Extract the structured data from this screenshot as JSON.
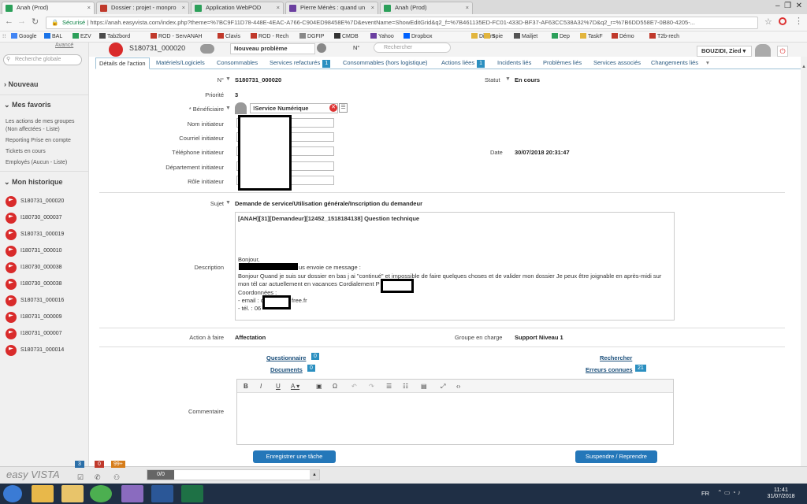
{
  "browser": {
    "tabs": [
      {
        "label": "Anah (Prod)",
        "color": "#2ca05a"
      },
      {
        "label": "Dossier : projet - monpro",
        "color": "#c0392b"
      },
      {
        "label": "Application WebPOD",
        "color": "#2ca05a"
      },
      {
        "label": "Pierre Ménès : quand un",
        "color": "#6b3fa0"
      },
      {
        "label": "Anah (Prod)",
        "color": "#2ca05a"
      }
    ],
    "secure_label": "Sécurisé",
    "url": "https://anah.easyvista.com/index.php?theme=%7BC9F11D78-448E-4EAC-A766-C904ED98458E%7D&eventName=ShowEditGrid&q2_f=%7B461135ED-FC01-433D-BF37-AF63CC538A32%7D&q2_r=%7B6DD558E7-0B80-4205-...",
    "bookmarks": [
      "Google",
      "BAL",
      "EZV",
      "Tab2bord",
      "ROD - ServANAH",
      "Clavis",
      "ROD - Rech",
      "DGFIP",
      "CMDB",
      "Yahoo",
      "Dropbox",
      "Divers",
      "Spie",
      "Mailjet",
      "Dep",
      "TaskF",
      "Démo",
      "T2b-rech"
    ]
  },
  "header": {
    "ticket_id": "S180731_000020",
    "ticket_type": "Nouveau problème",
    "search_prefix": "N°",
    "search_placeholder": "Rechercher",
    "user": "BOUZIDI, Zied"
  },
  "sidebar": {
    "avance": "Avancé",
    "search_placeholder": "Recherche globale",
    "nouveau": "Nouveau",
    "favoris": "Mes favoris",
    "fav_items": [
      "Les actions de mes groupes",
      "(Non affectées - Liste)",
      "Reporting Prise en compte",
      "Tickets en cours",
      "Employés (Aucun - Liste)"
    ],
    "historique": "Mon historique",
    "history": [
      "S180731_000020",
      "I180730_000037",
      "S180731_000019",
      "I180731_000010",
      "I180730_000038",
      "I180730_000038",
      "S180731_000016",
      "I180731_000009",
      "I180731_000007",
      "S180731_000014"
    ]
  },
  "tabs": [
    {
      "label": "Détails de l'action"
    },
    {
      "label": "Matériels/Logiciels"
    },
    {
      "label": "Consommables"
    },
    {
      "label": "Services refacturés",
      "badge": "1"
    },
    {
      "label": "Consommables (hors logistique)"
    },
    {
      "label": "Actions liées",
      "badge": "1"
    },
    {
      "label": "Incidents liés"
    },
    {
      "label": "Problèmes liés"
    },
    {
      "label": "Services associés"
    },
    {
      "label": "Changements liés"
    }
  ],
  "form": {
    "numero_label": "N°",
    "numero": "S180731_000020",
    "statut_label": "Statut",
    "statut": "En cours",
    "priorite_label": "Priorité",
    "priorite": "3",
    "beneficiaire_label": "* Bénéficiaire",
    "beneficiaire": "!Service Numérique",
    "nom_label": "Nom initiateur",
    "courriel_label": "Courriel initiateur",
    "telephone_label": "Téléphone initiateur",
    "departement_label": "Département initiateur",
    "role_label": "Rôle initiateur",
    "date_label": "Date",
    "date": "30/07/2018 20:31:47",
    "sujet_label": "Sujet",
    "sujet": "Demande de service/Utilisation générale/Inscription du demandeur",
    "description_label": "Description",
    "description": {
      "title": "[ANAH][31][Demandeur][12452_1518184138] Question technique",
      "hello": "Bonjour,",
      "line1": "us envoie ce message :",
      "line2": "Bonjour Quand je suis sur dossier en bas j ai \"continué\" et impossible de faire quelques choses et de valider mon dossier Je peux être joignable en après-midi sur",
      "line3": "mon tél car actuellement en vacances Cordialement P",
      "line4": "Coordonnées :",
      "line5": "- email : c",
      "line5b": "free.fr",
      "line6": "- tél. : 06"
    },
    "action_label": "Action à faire",
    "action": "Affectation",
    "groupe_label": "Groupe en charge",
    "groupe": "Support Niveau 1",
    "questionnaire": "Questionnaire",
    "questionnaire_count": "0",
    "documents": "Documents",
    "documents_count": "0",
    "rechercher": "Rechercher",
    "erreurs": "Erreurs connues",
    "erreurs_count": "21",
    "commentaire_label": "Commentaire",
    "btn_enregistrer": "Enregistrer une tâche",
    "btn_suspendre": "Suspendre / Reprendre"
  },
  "footer": {
    "logo": "easy VISTA",
    "badges": [
      "3",
      "0",
      "99+"
    ],
    "progress": "0/0"
  },
  "taskbar": {
    "lang": "FR",
    "time": "11:41",
    "date": "31/07/2018"
  }
}
